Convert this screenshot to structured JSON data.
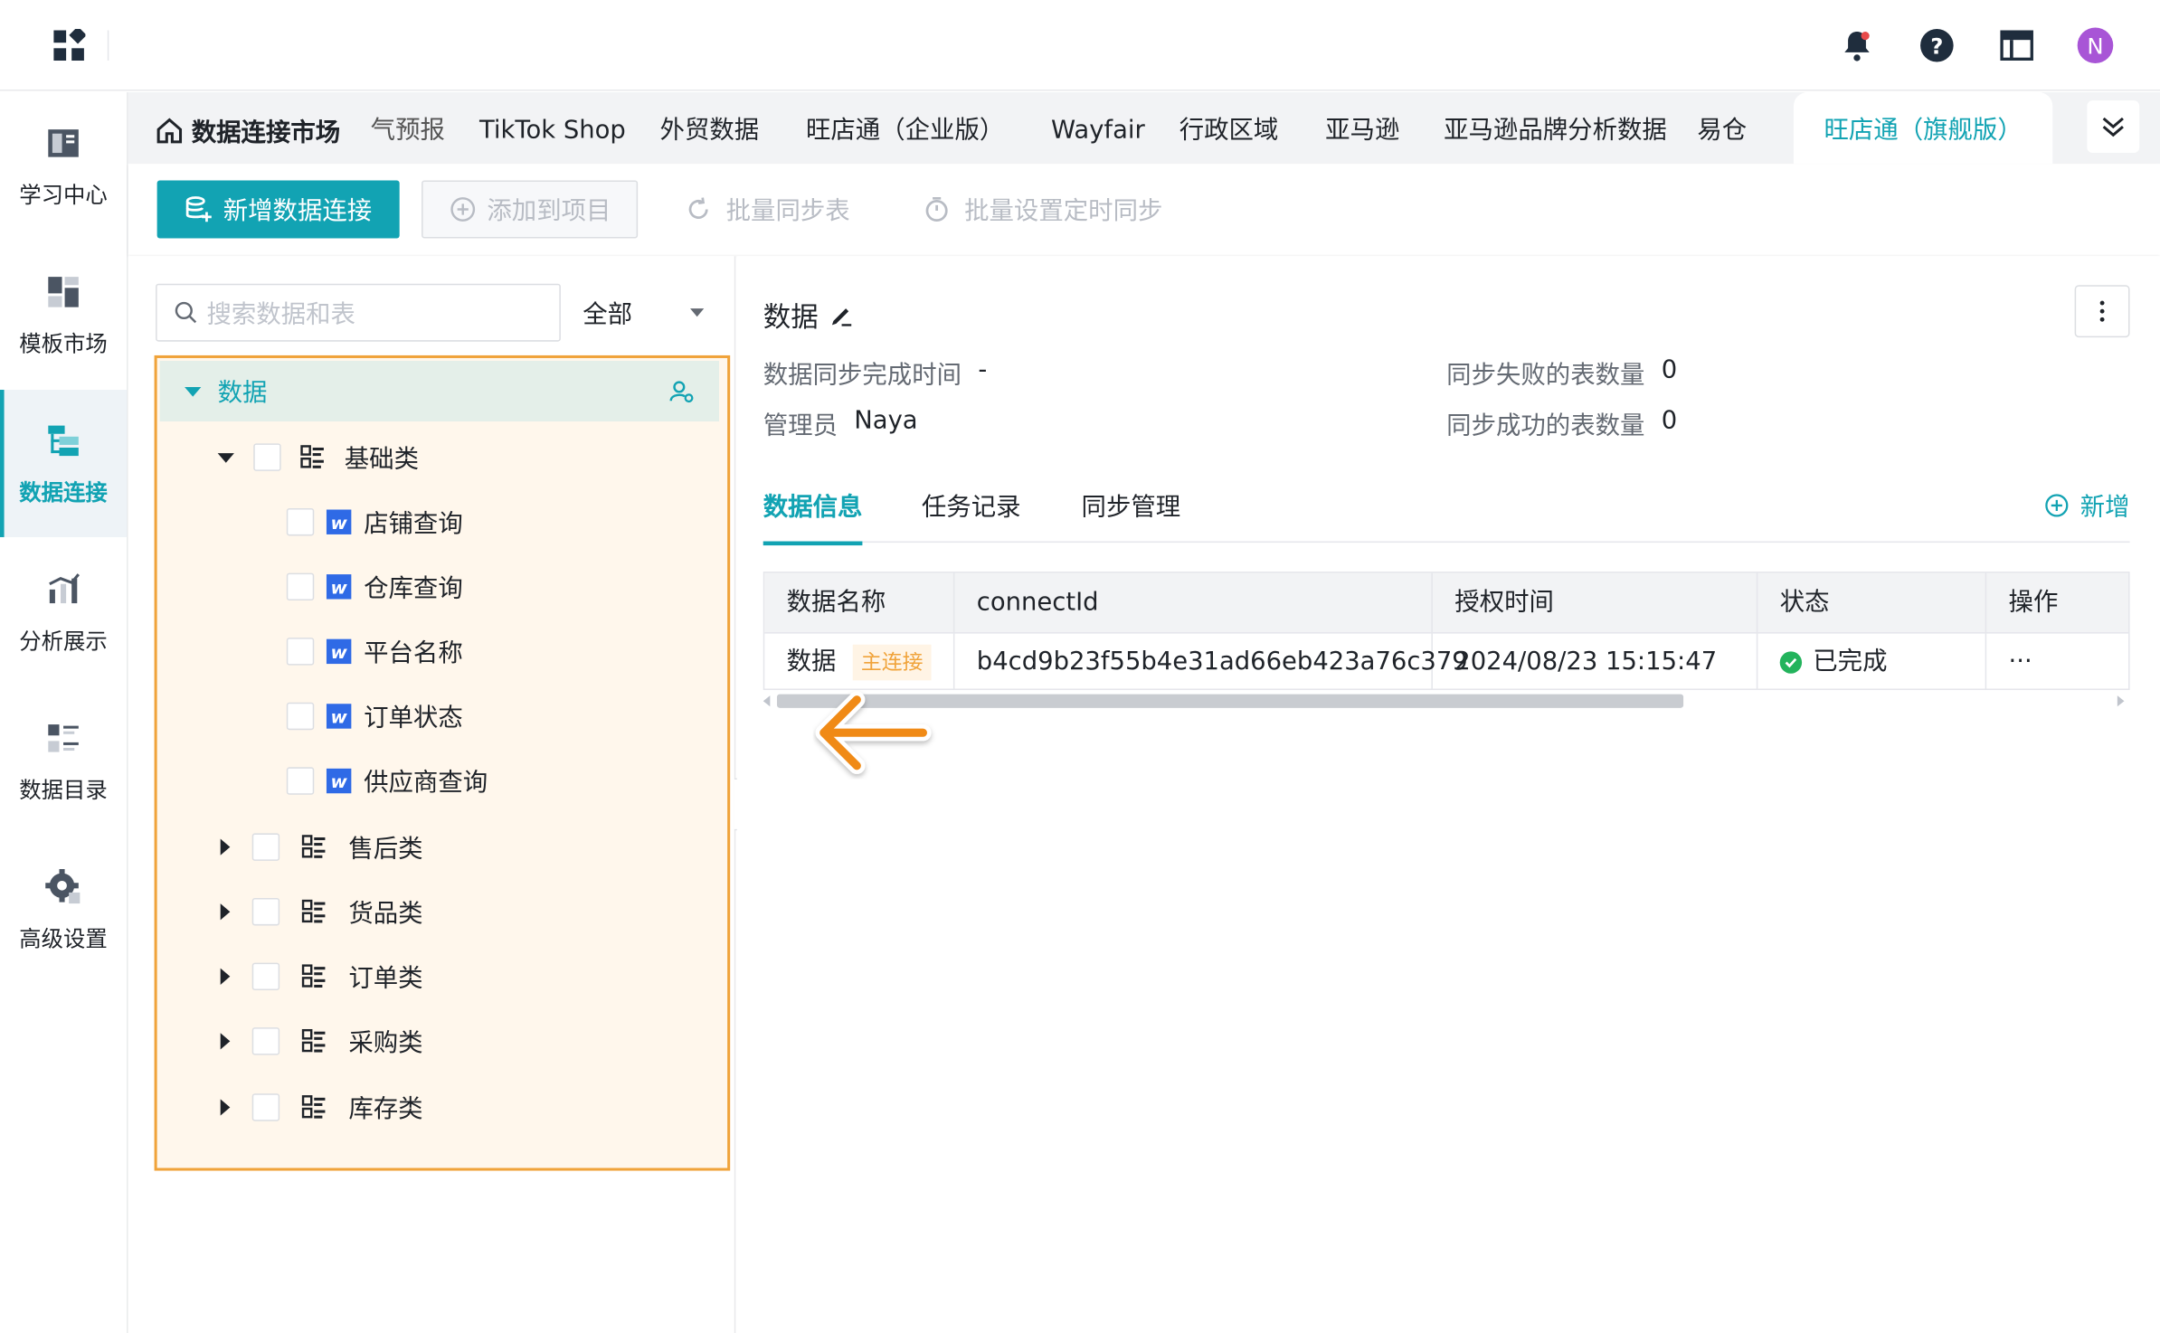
{
  "topbar": {
    "avatar_letter": "N",
    "icons": [
      "apps-icon",
      "bell-icon",
      "help-icon",
      "layout-icon"
    ]
  },
  "sidebar": {
    "items": [
      {
        "label": "学习中心",
        "icon": "book-icon"
      },
      {
        "label": "模板市场",
        "icon": "template-icon"
      },
      {
        "label": "数据连接",
        "icon": "data-connect-icon",
        "active": true
      },
      {
        "label": "分析展示",
        "icon": "chart-icon"
      },
      {
        "label": "数据目录",
        "icon": "catalog-icon"
      },
      {
        "label": "高级设置",
        "icon": "gear-icon"
      }
    ]
  },
  "tabs": {
    "home": "数据连接市场",
    "items": [
      "气预报",
      "TikTok Shop",
      "外贸数据",
      "旺店通（企业版）",
      "Wayfair",
      "行政区域",
      "亚马逊",
      "亚马逊品牌分析数据",
      "易仓"
    ],
    "active": "旺店通（旗舰版）"
  },
  "toolbar": {
    "new_connection": "新增数据连接",
    "add_to_project": "添加到项目",
    "batch_sync": "批量同步表",
    "batch_schedule": "批量设置定时同步"
  },
  "left_panel": {
    "search_placeholder": "搜索数据和表",
    "filter": "全部",
    "tree": {
      "root": "数据",
      "groups": [
        {
          "label": "基础类",
          "expanded": true,
          "children": [
            "店铺查询",
            "仓库查询",
            "平台名称",
            "订单状态",
            "供应商查询"
          ]
        },
        {
          "label": "售后类",
          "expanded": false
        },
        {
          "label": "货品类",
          "expanded": false
        },
        {
          "label": "订单类",
          "expanded": false
        },
        {
          "label": "采购类",
          "expanded": false
        },
        {
          "label": "库存类",
          "expanded": false
        }
      ]
    }
  },
  "right_panel": {
    "title": "数据",
    "meta": {
      "sync_done_label": "数据同步完成时间",
      "sync_done_value": "-",
      "admin_label": "管理员",
      "admin_value": "Naya",
      "fail_label": "同步失败的表数量",
      "fail_value": "0",
      "success_label": "同步成功的表数量",
      "success_value": "0"
    },
    "tabs": [
      "数据信息",
      "任务记录",
      "同步管理"
    ],
    "add_label": "新增",
    "table": {
      "headers": [
        "数据名称",
        "connectId",
        "授权时间",
        "状态",
        "操作"
      ],
      "rows": [
        {
          "name": "数据",
          "badge": "主连接",
          "connectId": "b4cd9b23f55b4e31ad66eb423a76c379",
          "auth_time": "2024/08/23 15:15:47",
          "status": "已完成",
          "action": "···"
        }
      ]
    }
  },
  "colors": {
    "accent": "#12a3b3",
    "highlight_border": "#f0a33a",
    "success": "#23b35c"
  }
}
